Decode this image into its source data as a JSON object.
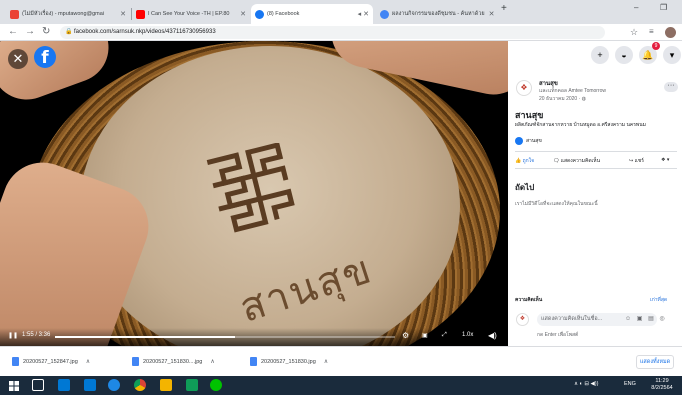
{
  "browser": {
    "tabs": [
      {
        "title": "(ไม่มีหัวเรื่อง) - mputawong@gmai",
        "favicon_color": "#ea4335"
      },
      {
        "title": "I Can See Your Voice -TH | EP.80",
        "favicon_color": "#ff0000"
      },
      {
        "title": "(8) Facebook",
        "favicon_color": "#1877f2"
      },
      {
        "title": "ผลงานกิจกรรมของดีชุมชน - ค้นหาด้วย",
        "favicon_color": "#4285f4"
      }
    ],
    "url": "facebook.com/sarnsuk.nkp/videos/437116730956933"
  },
  "video": {
    "brand_text": "สานสุข",
    "time": "1:55 / 3:36",
    "progress": 0.53,
    "speed": "1.0x"
  },
  "panel": {
    "page_name": "สานสุข",
    "with_text": "และแท็กคอล Amtee Tomorrow",
    "date": "20 ธันวาคม 2020 · ",
    "post_title": "สานสุข",
    "post_desc": "ผลิตภัณฑ์จักสานจากหวาย บ้านหมูดอ อ.ศรีสงคราม นครพนม",
    "page_link": "สานสุข",
    "like": "ถูกใจ",
    "comment": "แสดงความคิดเห็น",
    "share": "แชร์",
    "up_next_title": "ถัดไป",
    "up_next_text": "เราไม่มีวิดีโอที่จะแสดงให้คุณในขณะนี้",
    "comments_label": "ความคิดเห็น",
    "comments_sort": "เก่าที่สุด",
    "comment_placeholder": "แสดงความคิดเห็นในชื่อ...",
    "comment_hint": "กด Enter เพื่อโพสต์",
    "notifications": "9"
  },
  "downloads": {
    "files": [
      "20200527_152847.jpg",
      "20200527_151830....jpg",
      "20200527_151830.jpg"
    ],
    "show_all": "แสดงทั้งหมด"
  },
  "taskbar": {
    "time": "11:29",
    "date": "8/2/2564",
    "lang": "ENG",
    "colors": [
      "#0078d4",
      "#ffffff",
      "#f4b400",
      "#0f9d58",
      "#db4437",
      "#1e88e5",
      "#00c300"
    ]
  }
}
